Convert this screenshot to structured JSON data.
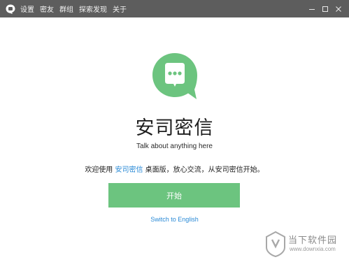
{
  "titlebar": {
    "menu": [
      "设置",
      "密友",
      "群组",
      "探索发现",
      "关于"
    ],
    "bg_color": "#5d5d5d"
  },
  "window_controls": [
    "minimize-icon",
    "maximize-icon",
    "close-icon"
  ],
  "main": {
    "logo_icon": "chat-bubble-icon",
    "product_name": "安司密信",
    "tagline": "Talk about anything here",
    "welcome_prefix": "欢迎使用 ",
    "welcome_link": "安司密信",
    "welcome_suffix": " 桌面版，放心交流，从安司密信开始。",
    "start_button": "开始",
    "switch_language": "Switch to English"
  },
  "watermark": {
    "title": "当下软件园",
    "url": "www.downxia.com"
  },
  "colors": {
    "brand_green": "#6cc47f",
    "link_blue": "#2a8ad6"
  }
}
